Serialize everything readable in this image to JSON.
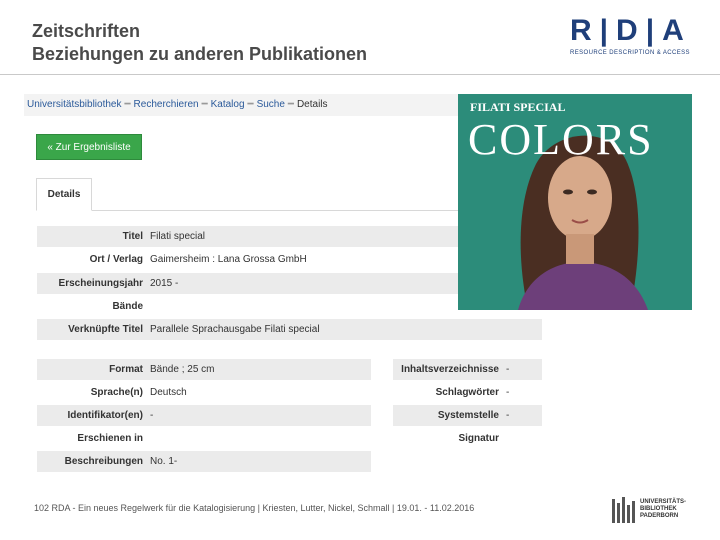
{
  "slide": {
    "title_line1": "Zeitschriften",
    "title_line2": "Beziehungen zu anderen Publikationen"
  },
  "logo": {
    "letters": "R|D|A",
    "subtitle": "RESOURCE DESCRIPTION & ACCESS",
    "color": "#1f3f7a"
  },
  "breadcrumb": {
    "items": [
      "Universitätsbibliothek",
      "Recherchieren",
      "Katalog",
      "Suche",
      "Details"
    ]
  },
  "back_button": {
    "label": "« Zur Ergebnisliste",
    "color": "#3aa64a"
  },
  "tabs": [
    {
      "label": "Details"
    }
  ],
  "details_full": [
    {
      "label": "Titel",
      "value": "Filati special"
    },
    {
      "label": "Ort / Verlag",
      "value": "Gaimersheim : Lana Grossa GmbH"
    },
    {
      "label": "Erscheinungsjahr",
      "value": "2015 -"
    },
    {
      "label": "Bände",
      "value": ""
    },
    {
      "label": "Verknüpfte Titel",
      "value": "Parallele Sprachausgabe Filati special"
    }
  ],
  "details_left": [
    {
      "label": "Format",
      "value": "Bände ; 25 cm"
    },
    {
      "label": "Sprache(n)",
      "value": "Deutsch"
    },
    {
      "label": "Identifikator(en)",
      "value": "-"
    },
    {
      "label": "Erschienen in",
      "value": ""
    },
    {
      "label": "Beschreibungen",
      "value": "No. 1-"
    }
  ],
  "details_right": [
    {
      "label": "Inhaltsverzeichnisse",
      "value": "-"
    },
    {
      "label": "Schlagwörter",
      "value": "-"
    },
    {
      "label": "Systemstelle",
      "value": "-"
    },
    {
      "label": "Signatur",
      "value": ""
    }
  ],
  "cover": {
    "brand": "FILATI SPECIAL",
    "title": "COLORS",
    "background_color": "#2c8c7a"
  },
  "footer": {
    "text": "102 RDA - Ein neues Regelwerk für die Katalogisierung | Kriesten, Lutter, Nickel, Schmall | 19.01. - 11.02.2016",
    "logo_text": "UNIVERSITÄTS-BIBLIOTHEK PADERBORN"
  }
}
